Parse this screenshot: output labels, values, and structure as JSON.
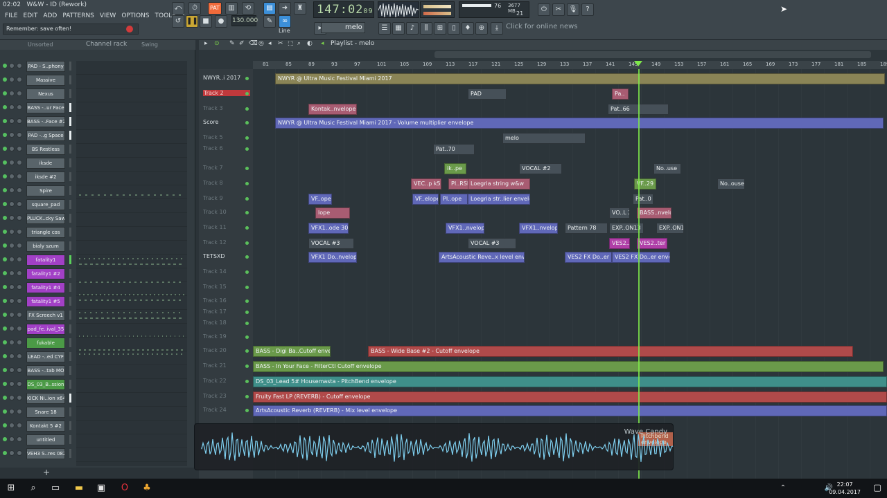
{
  "app": {
    "title": "W&W - ID (Rework)",
    "clock_small": "02:02",
    "hint": "Remember: save often!",
    "menu": [
      "FILE",
      "EDIT",
      "ADD",
      "PATTERNS",
      "VIEW",
      "OPTIONS",
      "TOOLS",
      "?"
    ]
  },
  "transport": {
    "pat_label": "PAT",
    "time": "147:02",
    "time_sub": "09",
    "tempo": "130.000",
    "pattern": "melo",
    "snap": "Line",
    "cpu": "76",
    "mem": "3677 MB",
    "poly": "21",
    "news": "Click for online news"
  },
  "channel_rack": {
    "filter": "Unsorted",
    "title": "Channel rack",
    "swing": "Swing",
    "channels": [
      {
        "name": "PAD - S..phony",
        "style": "grey",
        "ind": "off"
      },
      {
        "name": "Massive",
        "style": "grey",
        "ind": "off"
      },
      {
        "name": "Nexus",
        "style": "grey",
        "ind": "off"
      },
      {
        "name": "BASS -..ur Face",
        "style": "grey",
        "ind": "lit"
      },
      {
        "name": "BASS -..Face #2",
        "style": "grey",
        "ind": "lit"
      },
      {
        "name": "PAD -..g Space",
        "style": "grey",
        "ind": "lit"
      },
      {
        "name": "BS Restless",
        "style": "grey",
        "ind": "off"
      },
      {
        "name": "iksde",
        "style": "grey",
        "ind": "off"
      },
      {
        "name": "iksde #2",
        "style": "grey",
        "ind": "off"
      },
      {
        "name": "Spire",
        "style": "grey",
        "ind": "off"
      },
      {
        "name": "square_pad",
        "style": "grey",
        "ind": "off"
      },
      {
        "name": "PLUCK..cky Saw",
        "style": "grey",
        "ind": "off"
      },
      {
        "name": "triangle cos",
        "style": "grey",
        "ind": "off"
      },
      {
        "name": "bialy szum",
        "style": "grey",
        "ind": "off"
      },
      {
        "name": "fatality1",
        "style": "purple",
        "ind": "green"
      },
      {
        "name": "fatality1 #2",
        "style": "purple",
        "ind": "off"
      },
      {
        "name": "fatality1 #4",
        "style": "purple",
        "ind": "off"
      },
      {
        "name": "fatality1 #5",
        "style": "purple",
        "ind": "off"
      },
      {
        "name": "FX Screech v1",
        "style": "grey",
        "ind": "off"
      },
      {
        "name": "pad_fe..ival_35",
        "style": "purple",
        "ind": "off"
      },
      {
        "name": "fukable",
        "style": "green",
        "ind": "off"
      },
      {
        "name": "LEAD -..ed CYF",
        "style": "grey",
        "ind": "off"
      },
      {
        "name": "BASS -..tab MO",
        "style": "grey",
        "ind": "off"
      },
      {
        "name": "DS_03_B..ssion",
        "style": "green",
        "ind": "off"
      },
      {
        "name": "KICK Ni..ion x64",
        "style": "grey",
        "ind": "lit"
      },
      {
        "name": "Snare 18",
        "style": "grey",
        "ind": "off"
      },
      {
        "name": "Kontakt 5 #2",
        "style": "grey",
        "ind": "off"
      },
      {
        "name": "untitled",
        "style": "grey",
        "ind": "off"
      },
      {
        "name": "VEH3 S..res 082",
        "style": "grey",
        "ind": "off"
      }
    ]
  },
  "playlist": {
    "title": "Playlist - melo",
    "ruler": [
      "81",
      "85",
      "89",
      "93",
      "97",
      "101",
      "105",
      "109",
      "113",
      "117",
      "121",
      "125",
      "129",
      "133",
      "137",
      "141",
      "145",
      "149",
      "153",
      "157",
      "161",
      "165",
      "169",
      "173",
      "177",
      "181",
      "185",
      "189"
    ],
    "tracks": [
      {
        "label": "NWYR..i 2017",
        "style": "bright"
      },
      {
        "label": "Track 2",
        "style": "red"
      },
      {
        "label": "Track 3",
        "style": "dim"
      },
      {
        "label": "Score",
        "style": "bright"
      },
      {
        "label": "Track 5",
        "style": "dim"
      },
      {
        "label": "Track 6",
        "style": "dim"
      },
      {
        "label": "Track 7",
        "style": "dim"
      },
      {
        "label": "Track 8",
        "style": "dim"
      },
      {
        "label": "Track 9",
        "style": "dim"
      },
      {
        "label": "Track 10",
        "style": "dim"
      },
      {
        "label": "Track 11",
        "style": "dim"
      },
      {
        "label": "Track 12",
        "style": "dim"
      },
      {
        "label": "TETSXD",
        "style": "bright"
      },
      {
        "label": "Track 14",
        "style": "dim"
      },
      {
        "label": "Track 15",
        "style": "dim"
      },
      {
        "label": "Track 16",
        "style": "dim"
      },
      {
        "label": "Track 17",
        "style": "dim"
      },
      {
        "label": "Track 18",
        "style": "dim"
      },
      {
        "label": "Track 19",
        "style": "dim"
      },
      {
        "label": "Track 20",
        "style": "dim"
      },
      {
        "label": "Track 21",
        "style": "dim"
      },
      {
        "label": "Track 22",
        "style": "dim"
      },
      {
        "label": "Track 23",
        "style": "dim"
      },
      {
        "label": "Track 24",
        "style": "dim"
      }
    ],
    "clips": [
      {
        "track": 0,
        "text": "NWYR @ Ultra Music Festival Miami 2017",
        "style": "olive"
      },
      {
        "track": 1,
        "text": "PAD",
        "style": "darkgrey"
      },
      {
        "track": 1,
        "text": "Pa..",
        "style": "pink"
      },
      {
        "track": 2,
        "text": "Kontak..nvelope",
        "style": "pink"
      },
      {
        "track": 2,
        "text": "Pat..66",
        "style": "darkgrey"
      },
      {
        "track": 3,
        "text": "NWYR @ Ultra Music Festival Miami 2017 - Volume multiplier envelope",
        "style": "purple"
      },
      {
        "track": 4,
        "text": "melo",
        "style": "darkgrey"
      },
      {
        "track": 5,
        "text": "Pat..70",
        "style": "darkgrey"
      },
      {
        "track": 6,
        "text": "ik..pe",
        "style": "green"
      },
      {
        "track": 6,
        "text": "VOCAL #2",
        "style": "darkgrey"
      },
      {
        "track": 6,
        "text": "No..use",
        "style": "darkgrey"
      },
      {
        "track": 7,
        "text": "VEC..p k5",
        "style": "pink"
      },
      {
        "track": 7,
        "text": "PI..RSE",
        "style": "pink"
      },
      {
        "track": 7,
        "text": "Loegria string w&w",
        "style": "pink"
      },
      {
        "track": 7,
        "text": "VF..29",
        "style": "green"
      },
      {
        "track": 7,
        "text": "No..ouse",
        "style": "darkgrey"
      },
      {
        "track": 8,
        "text": "VF..ope",
        "style": "purple"
      },
      {
        "track": 8,
        "text": "VF..elope",
        "style": "purple"
      },
      {
        "track": 8,
        "text": "PI..ope",
        "style": "purple"
      },
      {
        "track": 8,
        "text": "Loegria str..lier envelope",
        "style": "purple"
      },
      {
        "track": 8,
        "text": "Pat..0",
        "style": "darkgrey"
      },
      {
        "track": 9,
        "text": "lope",
        "style": "pink"
      },
      {
        "track": 9,
        "text": "VO..L 2",
        "style": "darkgrey"
      },
      {
        "track": 9,
        "text": "BASS..nvelope",
        "style": "pink"
      },
      {
        "track": 10,
        "text": "VFX1..ode 30",
        "style": "purple"
      },
      {
        "track": 10,
        "text": "VFX1..nvelope",
        "style": "purple"
      },
      {
        "track": 10,
        "text": "VFX1..nvelope",
        "style": "purple"
      },
      {
        "track": 10,
        "text": "Pattern 78",
        "style": "darkgrey"
      },
      {
        "track": 10,
        "text": "EXP..ON13",
        "style": "darkgrey"
      },
      {
        "track": 10,
        "text": "EXP..ON13",
        "style": "darkgrey"
      },
      {
        "track": 11,
        "text": "VOCAL #3",
        "style": "darkgrey"
      },
      {
        "track": 11,
        "text": "VOCAL #3",
        "style": "darkgrey"
      },
      {
        "track": 11,
        "text": "VES2..",
        "style": "magenta"
      },
      {
        "track": 11,
        "text": "VES2..ter 19",
        "style": "magenta"
      },
      {
        "track": 12,
        "text": "VFX1 Do..nvelope",
        "style": "purple"
      },
      {
        "track": 12,
        "text": "ArtsAcoustic Reve..x level envelope",
        "style": "purple"
      },
      {
        "track": 12,
        "text": "VES2 FX Do..er en",
        "style": "purple"
      },
      {
        "track": 12,
        "text": "VES2 FX Do..er envelope",
        "style": "purple"
      },
      {
        "track": 19,
        "text": "BASS - Digi Ba..Cutoff envelope",
        "style": "green"
      },
      {
        "track": 19,
        "text": "BASS - Wide Base #2 - Cutoff envelope",
        "style": "red"
      },
      {
        "track": 20,
        "text": "BASS - In Your Face - FilterCtl Cutoff envelope",
        "style": "green"
      },
      {
        "track": 21,
        "text": "DS_03_Lead 5# Housemasta - PitchBend envelope",
        "style": "teal"
      },
      {
        "track": 22,
        "text": "Fruity Fast LP (REVERB) - Cutoff envelope",
        "style": "red"
      },
      {
        "track": 23,
        "text": "ArtsAcoustic Reverb (REVERB) - Mix level envelope",
        "style": "purple"
      }
    ]
  },
  "wave_candy": {
    "title": "Wave Candy",
    "behind": "Pitchbend envelope"
  },
  "taskbar": {
    "time": "22:07",
    "date": "09.04.2017"
  },
  "colors": {
    "accent_orange": "#f06a3a",
    "accent_blue": "#3c8fd8",
    "playhead_green": "#7ee84a",
    "purple_channel": "#a240c6",
    "green_channel": "#4b9a46"
  }
}
